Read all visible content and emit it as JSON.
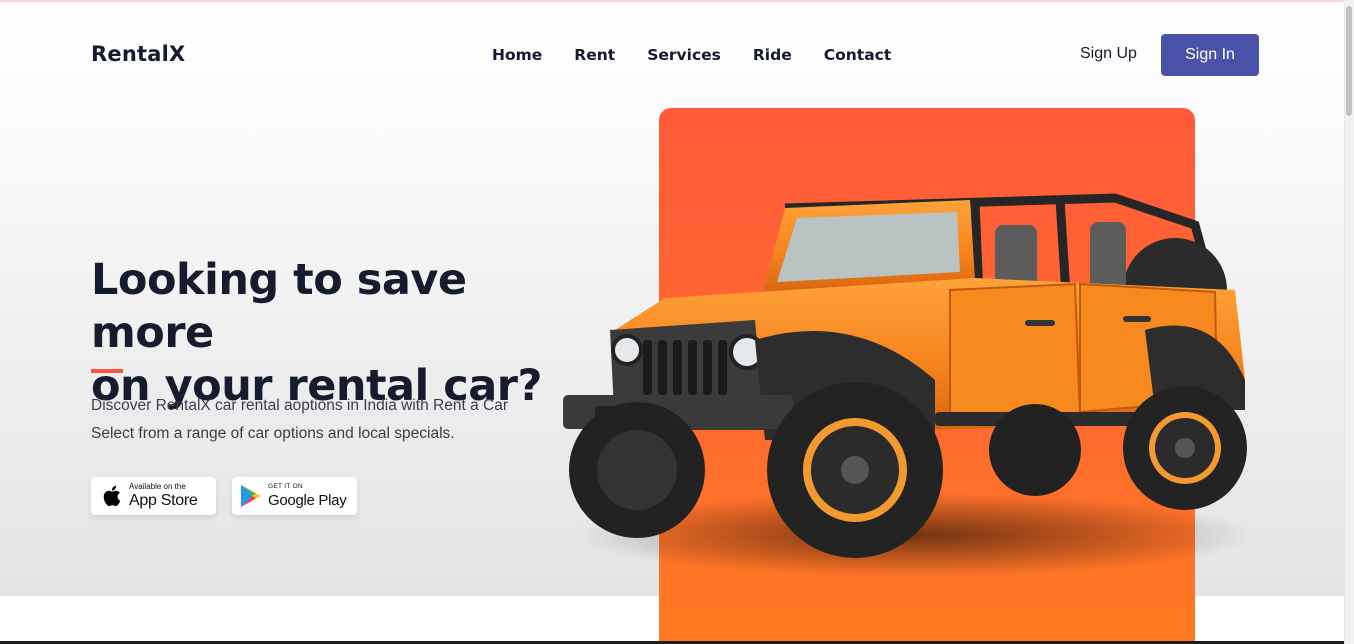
{
  "brand": {
    "name": "RentalX"
  },
  "nav": {
    "items": [
      "Home",
      "Rent",
      "Services",
      "Ride",
      "Contact"
    ]
  },
  "auth": {
    "sign_up": "Sign Up",
    "sign_in": "Sign In"
  },
  "hero": {
    "headline_line1": "Looking to save more",
    "headline_line2": "on your rental car?",
    "description_line1": "Discover RentalX car rental aoptions in India with Rent a Car",
    "description_line2": "Select from a range of car options and local specials."
  },
  "stores": {
    "app_store": {
      "small": "Available on the",
      "big": "App Store",
      "icon": "apple-icon"
    },
    "google_play": {
      "small": "GET IT ON",
      "big": "Google Play",
      "icon": "google-play-icon"
    }
  },
  "colors": {
    "accent": "#f15a3f",
    "primary_button": "#4a52a8",
    "panel_orange": "#ff6a30",
    "text_dark": "#161c2d"
  }
}
